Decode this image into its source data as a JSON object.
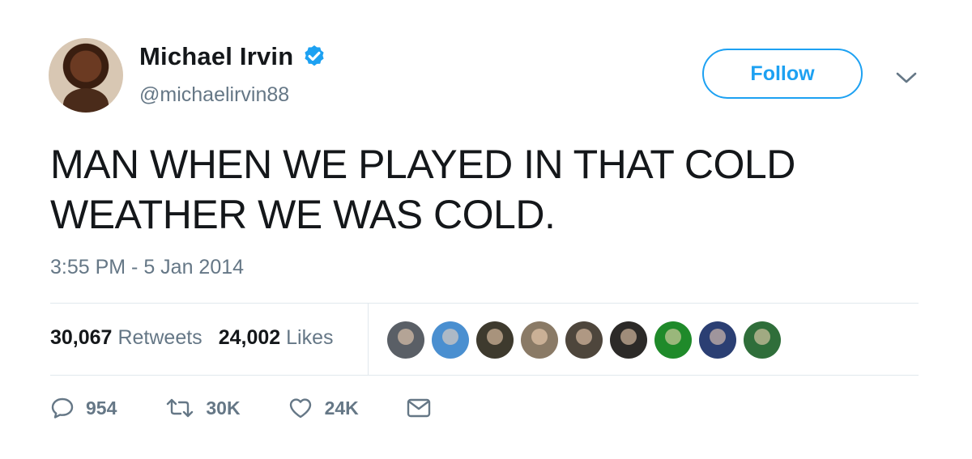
{
  "author": {
    "name": "Michael Irvin",
    "handle": "@michaelirvin88",
    "verified": true
  },
  "follow_button": {
    "label": "Follow"
  },
  "tweet": {
    "text": "MAN WHEN WE PLAYED IN THAT COLD WEATHER WE WAS COLD.",
    "timestamp": "3:55 PM - 5 Jan 2014"
  },
  "stats": {
    "retweets_count": "30,067",
    "retweets_label": "Retweets",
    "likes_count": "24,002",
    "likes_label": "Likes"
  },
  "likers": [
    {
      "color": "#5a5f66"
    },
    {
      "color": "#4a8fd0"
    },
    {
      "color": "#3e3a2e"
    },
    {
      "color": "#8a7a66"
    },
    {
      "color": "#4e463c"
    },
    {
      "color": "#2c2a28"
    },
    {
      "color": "#1f8a2a"
    },
    {
      "color": "#2b3f73"
    },
    {
      "color": "#2f6e3a"
    }
  ],
  "actions": {
    "reply_count": "954",
    "retweet_count": "30K",
    "like_count": "24K"
  },
  "colors": {
    "accent": "#1da1f2",
    "text": "#14171a",
    "muted": "#657786",
    "divider": "#e1e8ed"
  }
}
